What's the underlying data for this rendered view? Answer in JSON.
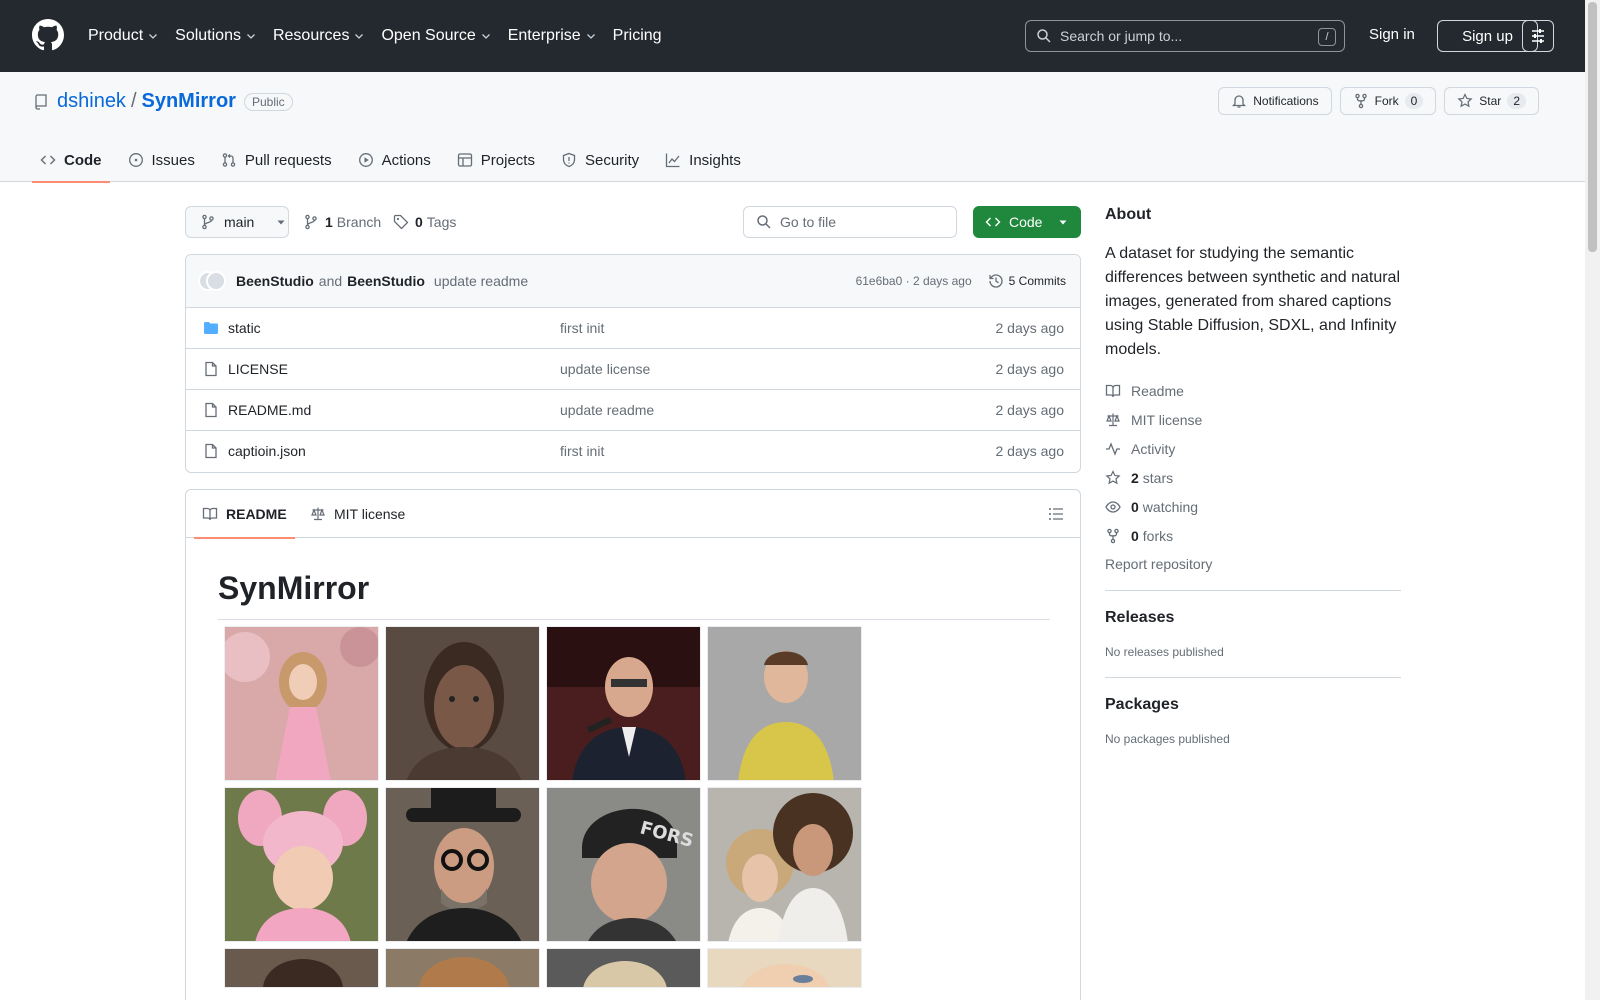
{
  "header": {
    "nav": [
      "Product",
      "Solutions",
      "Resources",
      "Open Source",
      "Enterprise",
      "Pricing"
    ],
    "search_placeholder": "Search or jump to...",
    "search_shortcut": "/",
    "signin": "Sign in",
    "signup": "Sign up"
  },
  "repo": {
    "owner": "dshinek",
    "separator": "/",
    "name": "SynMirror",
    "visibility": "Public",
    "notifications": "Notifications",
    "fork": "Fork",
    "fork_count": "0",
    "star": "Star",
    "star_count": "2"
  },
  "tabs": [
    "Code",
    "Issues",
    "Pull requests",
    "Actions",
    "Projects",
    "Security",
    "Insights"
  ],
  "toolbar": {
    "branch": "main",
    "branches_count": "1",
    "branches_label": "Branch",
    "tags_count": "0",
    "tags_label": "Tags",
    "goto_placeholder": "Go to file",
    "code_button": "Code"
  },
  "commit": {
    "author1": "BeenStudio",
    "and": "and",
    "author2": "BeenStudio",
    "message": "update readme",
    "hash_time": "61e6ba0 · 2 days ago",
    "commits": "5 Commits"
  },
  "files": [
    {
      "type": "folder",
      "name": "static",
      "message": "first init",
      "date": "2 days ago"
    },
    {
      "type": "file",
      "name": "LICENSE",
      "message": "update license",
      "date": "2 days ago"
    },
    {
      "type": "file",
      "name": "README.md",
      "message": "update readme",
      "date": "2 days ago"
    },
    {
      "type": "file",
      "name": "captioin.json",
      "message": "first init",
      "date": "2 days ago"
    }
  ],
  "readme": {
    "tab_readme": "README",
    "tab_license": "MIT license",
    "title": "SynMirror"
  },
  "about": {
    "heading": "About",
    "description": "A dataset for studying the semantic differences between synthetic and natural images, generated from shared captions using Stable Diffusion, SDXL, and Infinity models.",
    "readme": "Readme",
    "license": "MIT license",
    "activity": "Activity",
    "stars_count": "2",
    "stars_label": "stars",
    "watching_count": "0",
    "watching_label": "watching",
    "forks_count": "0",
    "forks_label": "forks",
    "report": "Report repository"
  },
  "releases": {
    "heading": "Releases",
    "note": "No releases published"
  },
  "packages": {
    "heading": "Packages",
    "note": "No packages published"
  },
  "colors": {
    "accent": "#0969da",
    "primary_button": "#1f883d",
    "header_bg": "#24292f",
    "tab_underline": "#fd8c73"
  },
  "gallery_icons": [
    "photo-girl-pink-dress",
    "photo-woman-mud-face",
    "photo-man-microphone",
    "photo-boy-yellow-shirt",
    "photo-girl-pink-hat",
    "photo-man-hat-glasses",
    "photo-man-black-beanie",
    "photo-couple-curly-hair",
    "photo-partial-1",
    "photo-partial-2",
    "photo-partial-3",
    "photo-partial-4"
  ]
}
